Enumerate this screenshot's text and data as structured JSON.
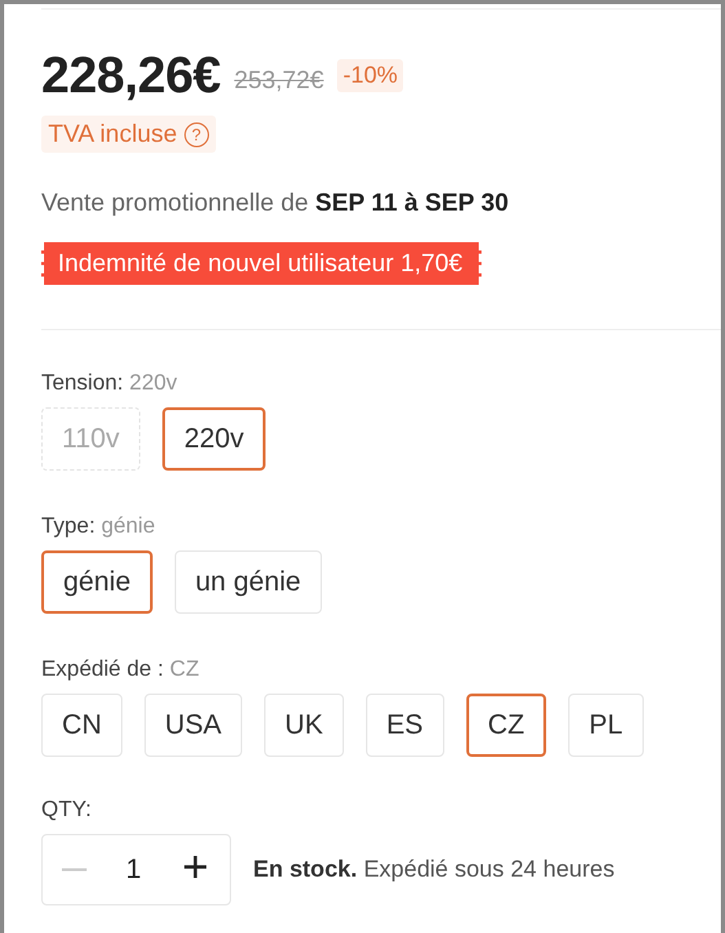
{
  "price": {
    "current": "228,26€",
    "original": "253,72€",
    "discount": "-10%"
  },
  "tax_note": {
    "label": "TVA incluse",
    "help": "?"
  },
  "promo": "Vente promotionnelle de **SEP 11 à SEP 30**",
  "coupon": "Indemnité de nouvel utilisateur 1,70€",
  "option_groups": [
    {
      "label": "Tension:",
      "value": "220v",
      "options": [
        {
          "label": "110v",
          "selected": false,
          "disabled": true
        },
        {
          "label": "220v",
          "selected": true,
          "disabled": false
        }
      ]
    },
    {
      "label": "Type:",
      "value": "génie",
      "options": [
        {
          "label": "génie",
          "selected": true,
          "disabled": false
        },
        {
          "label": "un génie",
          "selected": false,
          "disabled": false
        }
      ]
    },
    {
      "label": "Expédié de :",
      "value": "CZ",
      "options": [
        {
          "label": "CN",
          "selected": false,
          "disabled": false
        },
        {
          "label": "USA",
          "selected": false,
          "disabled": false
        },
        {
          "label": "UK",
          "selected": false,
          "disabled": false
        },
        {
          "label": "ES",
          "selected": false,
          "disabled": false
        },
        {
          "label": "CZ",
          "selected": true,
          "disabled": false
        },
        {
          "label": "PL",
          "selected": false,
          "disabled": false
        }
      ]
    }
  ],
  "quantity": {
    "label": "QTY:",
    "value": "1",
    "decrease_disabled": true,
    "increase_disabled": false,
    "stock": "**En stock.** Expédié sous 24 heures"
  }
}
